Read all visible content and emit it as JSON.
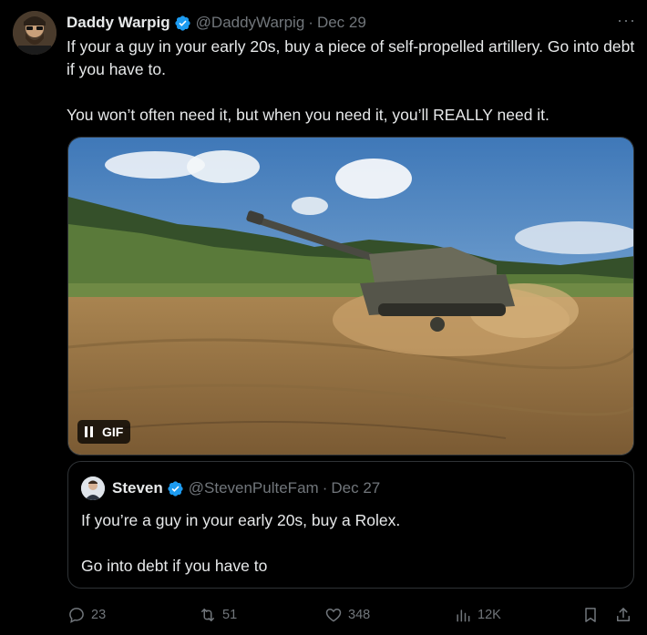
{
  "tweet": {
    "author_name": "Daddy Warpig",
    "handle": "@DaddyWarpig",
    "separator": "·",
    "date": "Dec 29",
    "more": "···",
    "text_line1": "If your a guy in your early 20s, buy a piece of self-propelled artillery. Go into debt if you have to.",
    "text_line2": "You won’t often need it, but when you need it, you’ll REALLY need it.",
    "media_badge": "GIF"
  },
  "quote": {
    "author_name": "Steven",
    "handle": "@StevenPulteFam",
    "separator": "·",
    "date": "Dec 27",
    "text_line1": "If you’re a guy in your early 20s, buy a Rolex.",
    "text_line2": "Go into debt if you have to"
  },
  "actions": {
    "replies": "23",
    "reposts": "51",
    "likes": "348",
    "views": "12K"
  },
  "colors": {
    "background": "#000000",
    "text": "#e7e9ea",
    "muted": "#71767b",
    "verified": "#1d9bf0",
    "border": "#2f3336"
  }
}
